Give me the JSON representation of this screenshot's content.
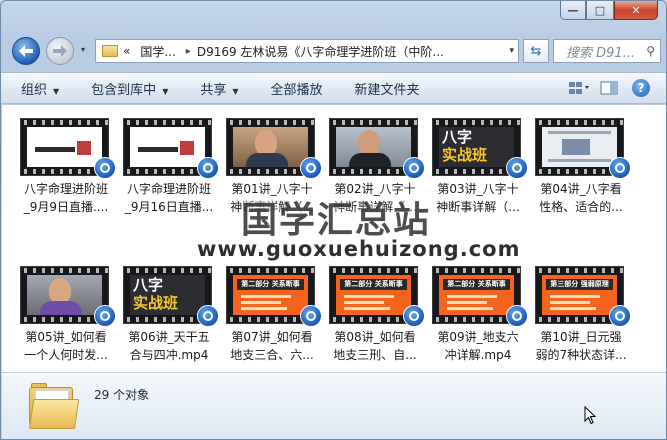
{
  "window": {
    "min_label": "—",
    "max_label": "□",
    "close_label": "✕"
  },
  "nav": {
    "back_icon": "arrow-left",
    "forward_icon": "arrow-right",
    "history_label": "▾"
  },
  "address": {
    "overflow": "«",
    "crumbs": [
      "国学...",
      "D9169 左林说易《八字命理学进阶班（中阶..."
    ],
    "separator": "▸"
  },
  "search": {
    "placeholder": "搜索 D91..."
  },
  "toolbar": {
    "organize": "组织",
    "include_library": "包含到库中",
    "share": "共享",
    "play_all": "全部播放",
    "new_folder": "新建文件夹"
  },
  "files": [
    {
      "name": "八字命理进阶班\n_9月9日直播....",
      "thumb": "slide"
    },
    {
      "name": "八字命理进阶班\n_9月16日直播...",
      "thumb": "slide"
    },
    {
      "name": "第01讲_八字十\n神断事详解（...",
      "thumb": "face"
    },
    {
      "name": "第02讲_八字十\n神断事详解（...",
      "thumb": "face2"
    },
    {
      "name": "第03讲_八字十\n神断事详解（...",
      "thumb": "title",
      "title": "八字",
      "subtitle": "实战班"
    },
    {
      "name": "第04讲_八字看\n性格、适合的...",
      "thumb": "news"
    },
    {
      "name": "第05讲_如何看\n一个人何时发...",
      "thumb": "purple"
    },
    {
      "name": "第06讲_天干五\n合与四冲.mp4",
      "thumb": "title",
      "title": "八字",
      "subtitle": "实战班"
    },
    {
      "name": "第07讲_如何看\n地支三合、六...",
      "thumb": "orange",
      "header": "第二部分 关系断事"
    },
    {
      "name": "第08讲_如何看\n地支三刑、自...",
      "thumb": "orange",
      "header": "第二部分 关系断事"
    },
    {
      "name": "第09讲_地支六\n冲详解.mp4",
      "thumb": "orange",
      "header": "第二部分 关系断事"
    },
    {
      "name": "第10讲_日元强\n弱的7种状态详...",
      "thumb": "orange",
      "header": "第三部分 强弱原理"
    }
  ],
  "watermark": {
    "title": "国学汇总站",
    "url": "www.guoxuehuizong.com"
  },
  "details": {
    "count": "29 个对象"
  }
}
